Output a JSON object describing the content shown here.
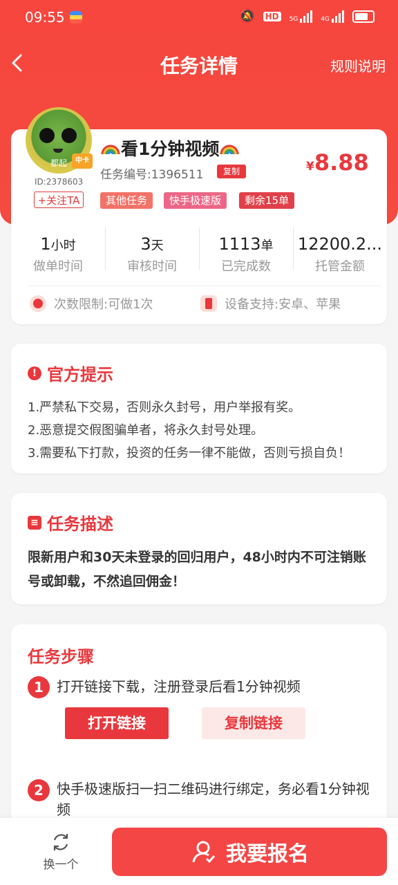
{
  "status_bar": {
    "time": "09:55",
    "hd": "HD",
    "net1": "5G",
    "net2": "4G"
  },
  "nav": {
    "title": "任务详情",
    "rule_link": "规则说明"
  },
  "task": {
    "user_id": "ID:2378603",
    "avatar_tag": "都起",
    "crown_text": "中卡",
    "follow_label": "+关注TA",
    "title": "看1分钟视频",
    "task_no_label": "任务编号:1396511",
    "copy_label": "复制",
    "price_symbol": "¥",
    "price": "8.88",
    "tags": [
      "其他任务",
      "快手极速版",
      "剩余15单"
    ]
  },
  "stats": [
    {
      "value": "1",
      "unit": "小时",
      "label": "做单时间"
    },
    {
      "value": "3",
      "unit": "天",
      "label": "审核时间"
    },
    {
      "value": "1113",
      "unit": "单",
      "label": "已完成数"
    },
    {
      "value": "12200.2...",
      "unit": "",
      "label": "托管金额"
    }
  ],
  "limits": {
    "count": "次数限制:可做1次",
    "device": "设备支持:安卓、苹果"
  },
  "official_tips": {
    "title": "官方提示",
    "items": [
      "1.严禁私下交易，否则永久封号，用户举报有奖。",
      "2.恶意提交假图骗单者，将永久封号处理。",
      "3.需要私下打款，投资的任务一律不能做，否则亏损自负！"
    ]
  },
  "description": {
    "title": "任务描述",
    "text": "限新用户和30天未登录的回归用户，48小时内不可注销账号或卸载，不然追回佣金！"
  },
  "steps": {
    "title": "任务步骤",
    "items": [
      {
        "num": "1",
        "text": "打开链接下载，注册登录后看1分钟视频"
      },
      {
        "num": "2",
        "text": "快手极速版扫一扫二维码进行绑定，务必看1分钟视频"
      }
    ],
    "open_link": "打开链接",
    "copy_link": "复制链接"
  },
  "bottom": {
    "swap_label": "换一个",
    "signup_label": "我要报名"
  },
  "colors": {
    "primary": "#e8383d",
    "header": "#f6463e"
  }
}
